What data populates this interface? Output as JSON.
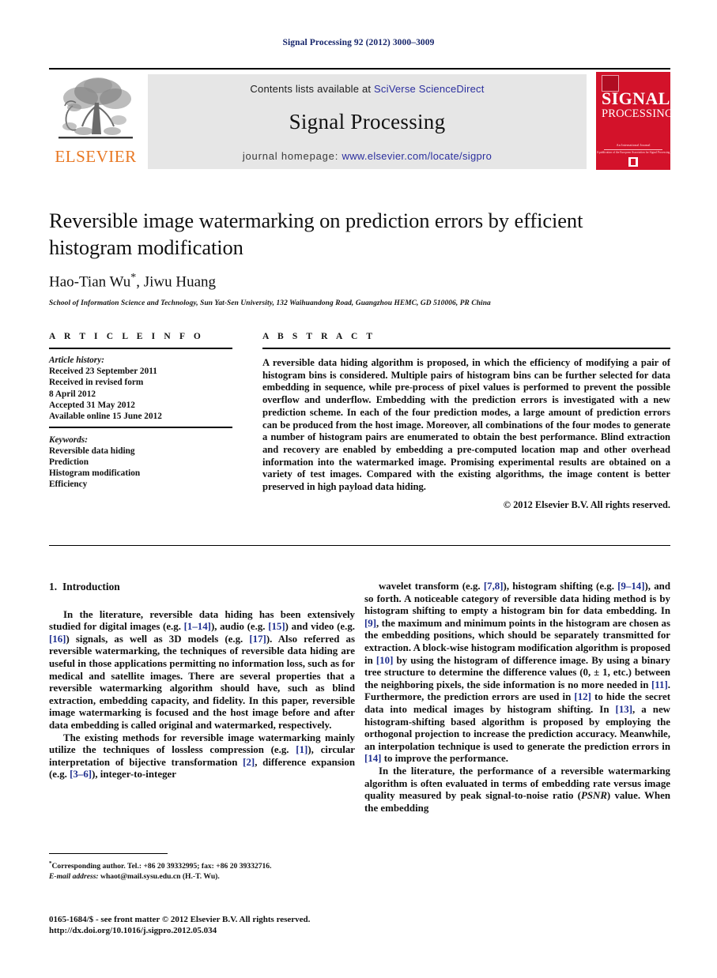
{
  "running_head": "Signal Processing 92 (2012) 3000–3009",
  "masthead": {
    "contents_prefix": "Contents lists available at ",
    "contents_link": "SciVerse ScienceDirect",
    "journal_title": "Signal Processing",
    "homepage_prefix": "journal homepage: ",
    "homepage_link": "www.elsevier.com/locate/sigpro",
    "publisher_name": "ELSEVIER",
    "publisher_logo_icon": "elsevier-tree-icon",
    "cover": {
      "line1": "SIGNAL",
      "line2": "PROCESSING",
      "tagline": "An International Journal",
      "subtagline": "A publication of the European Association for Signal Processing",
      "background_color": "#d3122a"
    }
  },
  "article": {
    "title": "Reversible image watermarking on prediction errors by efficient histogram modification",
    "authors": "Hao-Tian Wu",
    "authors_rest": ", Jiwu Huang",
    "corresponding_marker": "*",
    "affiliation": "School of Information Science and Technology, Sun Yat-Sen University, 132 Waihuandong Road, Guangzhou HEMC, GD 510006, PR China"
  },
  "article_info": {
    "heading": "A R T I C L E  I N F O",
    "history_label": "Article history:",
    "history": [
      "Received 23 September 2011",
      "Received in revised form",
      "8 April 2012",
      "Accepted 31 May 2012",
      "Available online 15 June 2012"
    ],
    "keywords_label": "Keywords:",
    "keywords": [
      "Reversible data hiding",
      "Prediction",
      "Histogram modification",
      "Efficiency"
    ]
  },
  "abstract": {
    "heading": "A B S T R A C T",
    "text": "A reversible data hiding algorithm is proposed, in which the efficiency of modifying a pair of histogram bins is considered. Multiple pairs of histogram bins can be further selected for data embedding in sequence, while pre-process of pixel values is performed to prevent the possible overflow and underflow. Embedding with the prediction errors is investigated with a new prediction scheme. In each of the four prediction modes, a large amount of prediction errors can be produced from the host image. Moreover, all combinations of the four modes to generate a number of histogram pairs are enumerated to obtain the best performance. Blind extraction and recovery are enabled by embedding a pre-computed location map and other overhead information into the watermarked image. Promising experimental results are obtained on a variety of test images. Compared with the existing algorithms, the image content is better preserved in high payload data hiding.",
    "copyright": "© 2012 Elsevier B.V. All rights reserved."
  },
  "body": {
    "section_number": "1.",
    "section_title": "Introduction",
    "left_paragraphs": [
      {
        "segments": [
          {
            "t": "In the literature, reversible data hiding has been extensively studied for digital images (e.g. "
          },
          {
            "t": "[1–14]",
            "ref": true
          },
          {
            "t": "), audio (e.g. "
          },
          {
            "t": "[15]",
            "ref": true
          },
          {
            "t": ") and video (e.g. "
          },
          {
            "t": "[16]",
            "ref": true
          },
          {
            "t": ") signals, as well as 3D models (e.g. "
          },
          {
            "t": "[17]",
            "ref": true
          },
          {
            "t": "). Also referred as reversible watermarking, the techniques of reversible data hiding are useful in those applications permitting no information loss, such as for medical and satellite images. There are several properties that a reversible watermarking algorithm should have, such as blind extraction, embedding capacity, and fidelity. In this paper, reversible image watermarking is focused and the host image before and after data embedding is called original and watermarked, respectively."
          }
        ]
      },
      {
        "segments": [
          {
            "t": "The existing methods for reversible image watermarking mainly utilize the techniques of lossless compression (e.g. "
          },
          {
            "t": "[1]",
            "ref": true
          },
          {
            "t": "), circular interpretation of bijective transformation "
          },
          {
            "t": "[2]",
            "ref": true
          },
          {
            "t": ", difference expansion (e.g. "
          },
          {
            "t": "[3–6]",
            "ref": true
          },
          {
            "t": "), integer-to-integer"
          }
        ]
      }
    ],
    "right_paragraphs": [
      {
        "segments": [
          {
            "t": "wavelet transform (e.g. "
          },
          {
            "t": "[7,8]",
            "ref": true
          },
          {
            "t": "), histogram shifting (e.g. "
          },
          {
            "t": "[9–14]",
            "ref": true
          },
          {
            "t": "), and so forth. A noticeable category of reversible data hiding method is by histogram shifting to empty a histogram bin for data embedding. In "
          },
          {
            "t": "[9]",
            "ref": true
          },
          {
            "t": ", the maximum and minimum points in the histogram are chosen as the embedding positions, which should be separately transmitted for extraction. A block-wise histogram modification algorithm is proposed in "
          },
          {
            "t": "[10]",
            "ref": true
          },
          {
            "t": " by using the histogram of difference image. By using a binary tree structure to determine the difference values (0, ± 1, etc.) between the neighboring pixels, the side information is no more needed in "
          },
          {
            "t": "[11]",
            "ref": true
          },
          {
            "t": ". Furthermore, the prediction errors are used in "
          },
          {
            "t": "[12]",
            "ref": true
          },
          {
            "t": " to hide the secret data into medical images by histogram shifting. In "
          },
          {
            "t": "[13]",
            "ref": true
          },
          {
            "t": ", a new histogram-shifting based algorithm is proposed by employing the orthogonal projection to increase the prediction accuracy. Meanwhile, an interpolation technique is used to generate the prediction errors in "
          },
          {
            "t": "[14]",
            "ref": true
          },
          {
            "t": " to improve the performance."
          }
        ]
      },
      {
        "segments": [
          {
            "t": "In the literature, the performance of a reversible watermarking algorithm is often evaluated in terms of embedding rate versus image quality measured by peak signal-to-noise ratio ("
          },
          {
            "t": "PSNR",
            "italic": true
          },
          {
            "t": ") value. When the embedding"
          }
        ]
      }
    ]
  },
  "footer": {
    "corresponding_marker": "*",
    "corresponding_note": "Corresponding author. Tel.: +86 20 39332995; fax: +86 20 39332716.",
    "email_label": "E-mail address:",
    "email": " whaot@mail.sysu.edu.cn (H.-T. Wu).",
    "issn_line": "0165-1684/$ - see front matter © 2012 Elsevier B.V. All rights reserved.",
    "doi_line": "http://dx.doi.org/10.1016/j.sigpro.2012.05.034"
  },
  "colors": {
    "link": "#2b2f9e",
    "reference": "#1f2f8f",
    "running_head": "#16256b",
    "elsevier_orange": "#e87722",
    "band_bg": "#e6e6e6"
  }
}
